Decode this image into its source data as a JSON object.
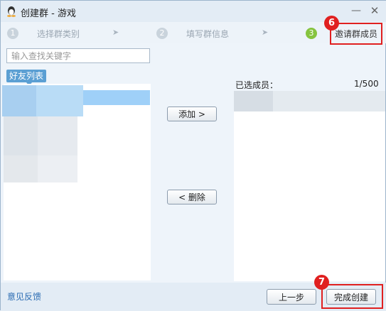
{
  "window": {
    "title": "创建群 - 游戏",
    "minimize_glyph": "—",
    "close_glyph": "✕"
  },
  "steps": [
    {
      "num": "1",
      "label": "选择群类别",
      "active": false
    },
    {
      "num": "2",
      "label": "填写群信息",
      "active": false
    },
    {
      "num": "3",
      "label": "邀请群成员",
      "active": true
    }
  ],
  "step_arrow": "➤",
  "search": {
    "placeholder": "输入查找关键字",
    "value": ""
  },
  "friends_tab": {
    "label": "好友列表"
  },
  "buttons": {
    "add": "添加 >",
    "remove": "< 删除",
    "prev": "上一步",
    "finish": "完成创建"
  },
  "selected": {
    "label": "已选成员：",
    "count": "1/500"
  },
  "footer": {
    "feedback": "意见反馈"
  },
  "annotations": {
    "badge6": "6",
    "badge7": "7"
  },
  "colors": {
    "accent": "#5b9fd3",
    "active_step": "#86c43f",
    "callout": "#e02020"
  },
  "icons": {
    "app": "qq-penguin-icon"
  }
}
